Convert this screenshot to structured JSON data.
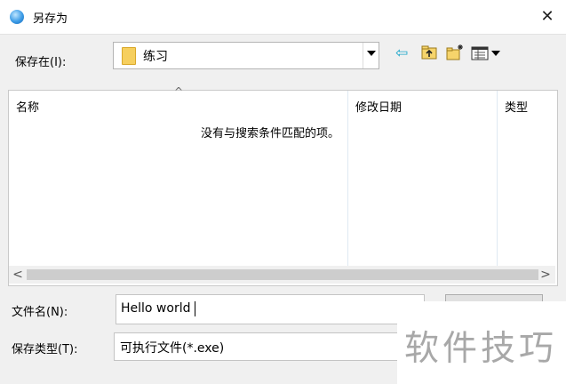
{
  "window": {
    "title": "另存为",
    "close_glyph": "✕"
  },
  "save_in": {
    "label": "保存在(I):",
    "value": "练习"
  },
  "toolbar": {
    "back_glyph": "⇦"
  },
  "file_list": {
    "columns": [
      "名称",
      "修改日期",
      "类型"
    ],
    "sort_indicator": "^",
    "empty_message": "没有与搜索条件匹配的项。"
  },
  "scrollbar": {
    "left_glyph": "<",
    "right_glyph": ">"
  },
  "filename": {
    "label": "文件名(N):",
    "value": "Hello world"
  },
  "filetype": {
    "label": "保存类型(T):",
    "value": "可执行文件(*.exe)"
  },
  "watermark": "软件技巧"
}
